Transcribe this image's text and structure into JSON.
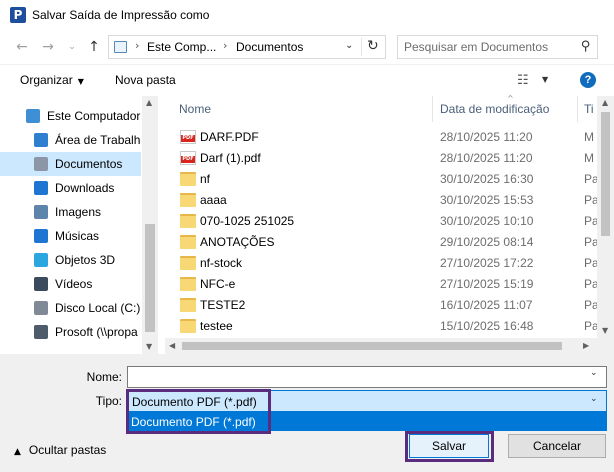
{
  "window": {
    "title": "Salvar Saída de Impressão como",
    "app_icon_glyph": "P"
  },
  "address": {
    "crumbs": [
      "Este Comp...",
      "Documentos"
    ],
    "search_placeholder": "Pesquisar em Documentos"
  },
  "toolbar": {
    "organize_label": "Organizar",
    "new_folder_label": "Nova pasta",
    "help_glyph": "?"
  },
  "nav_pane": {
    "items": [
      {
        "label": "Este Computador",
        "icon": "computer-icon",
        "indent": 0,
        "selected": false
      },
      {
        "label": "Área de Trabalho",
        "icon": "desktop-icon",
        "indent": 1,
        "selected": false
      },
      {
        "label": "Documentos",
        "icon": "documents-icon",
        "indent": 1,
        "selected": true
      },
      {
        "label": "Downloads",
        "icon": "downloads-icon",
        "indent": 1,
        "selected": false
      },
      {
        "label": "Imagens",
        "icon": "pictures-icon",
        "indent": 1,
        "selected": false
      },
      {
        "label": "Músicas",
        "icon": "music-icon",
        "indent": 1,
        "selected": false
      },
      {
        "label": "Objetos 3D",
        "icon": "3d-objects-icon",
        "indent": 1,
        "selected": false
      },
      {
        "label": "Vídeos",
        "icon": "videos-icon",
        "indent": 1,
        "selected": false
      },
      {
        "label": "Disco Local (C:)",
        "icon": "drive-icon",
        "indent": 1,
        "selected": false
      },
      {
        "label": "Prosoft (\\\\propa",
        "icon": "network-drive-icon",
        "indent": 1,
        "selected": false
      }
    ]
  },
  "file_list": {
    "columns": [
      "Nome",
      "Data de modificação",
      "Ti"
    ],
    "rows": [
      {
        "name": "DARF.PDF",
        "date": "28/10/2025 11:20",
        "type": "M",
        "kind": "pdf"
      },
      {
        "name": "Darf (1).pdf",
        "date": "28/10/2025 11:20",
        "type": "M",
        "kind": "pdf"
      },
      {
        "name": "nf",
        "date": "30/10/2025 16:30",
        "type": "Pa",
        "kind": "folder"
      },
      {
        "name": "aaaa",
        "date": "30/10/2025 15:53",
        "type": "Pa",
        "kind": "folder"
      },
      {
        "name": "070-1025 251025",
        "date": "30/10/2025 10:10",
        "type": "Pa",
        "kind": "folder"
      },
      {
        "name": "ANOTAÇÕES",
        "date": "29/10/2025 08:14",
        "type": "Pa",
        "kind": "folder"
      },
      {
        "name": "nf-stock",
        "date": "27/10/2025 17:22",
        "type": "Pa",
        "kind": "folder"
      },
      {
        "name": "NFC-e",
        "date": "27/10/2025 15:19",
        "type": "Pa",
        "kind": "folder"
      },
      {
        "name": "TESTE2",
        "date": "16/10/2025 11:07",
        "type": "Pa",
        "kind": "folder"
      },
      {
        "name": "testee",
        "date": "15/10/2025 16:48",
        "type": "Pa",
        "kind": "folder"
      }
    ]
  },
  "form": {
    "name_label": "Nome:",
    "name_value": "",
    "type_label": "Tipo:",
    "type_value": "Documento PDF (*.pdf)",
    "type_options": [
      "Documento PDF (*.pdf)"
    ],
    "hide_folders_label": "Ocultar pastas",
    "save_label": "Salvar",
    "cancel_label": "Cancelar"
  },
  "colors": {
    "accent": "#0078d7",
    "selection": "#cce8ff",
    "highlight_box": "#5a2c7e",
    "folder": "#f8d775",
    "pdf_red": "#d9251d"
  }
}
